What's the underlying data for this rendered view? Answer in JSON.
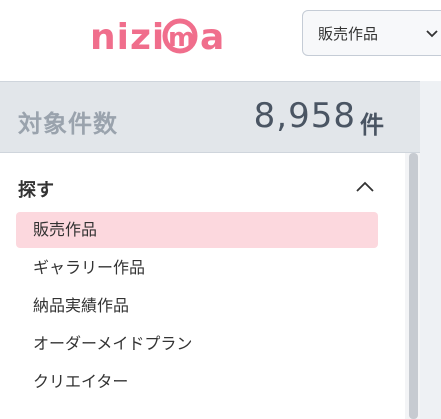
{
  "header": {
    "logo_text": "nizima",
    "category_select": {
      "value": "販売作品"
    }
  },
  "count_bar": {
    "label": "対象件数",
    "value": "8,958",
    "unit": "件"
  },
  "search_section": {
    "title": "探す",
    "expanded": true,
    "items": [
      {
        "label": "販売作品",
        "active": true
      },
      {
        "label": "ギャラリー作品",
        "active": false
      },
      {
        "label": "納品実績作品",
        "active": false
      },
      {
        "label": "オーダーメイドプラン",
        "active": false
      },
      {
        "label": "クリエイター",
        "active": false
      }
    ]
  },
  "colors": {
    "brand_pink": "#f06e8c",
    "active_item_bg": "#fcd8de",
    "count_bar_bg": "#e2e6ea"
  }
}
